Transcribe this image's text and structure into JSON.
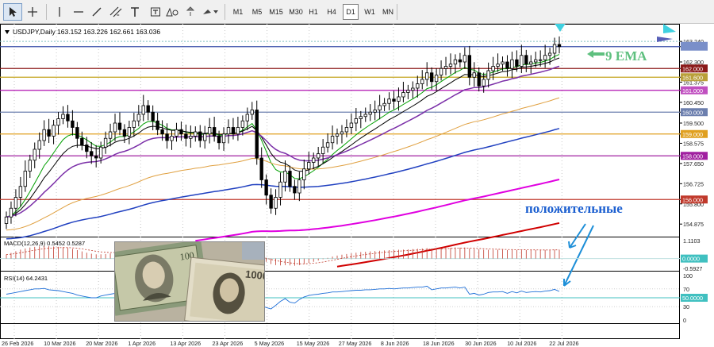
{
  "toolbar": {
    "timeframes": [
      "M1",
      "M5",
      "M15",
      "M30",
      "H1",
      "H4",
      "D1",
      "W1",
      "MN"
    ],
    "active_timeframe": "D1",
    "tools": [
      "cursor-icon",
      "crosshair-icon",
      "hline-icon",
      "trendline-icon",
      "channel-icon",
      "text-icon",
      "label-icon",
      "shapes-icon",
      "tools-more-icon"
    ]
  },
  "chart_data": {
    "type": "candlestick",
    "symbol_header": "USDJPY,Daily  163.152 163.226 162.661 163.036",
    "ylim": [
      154.3,
      163.9
    ],
    "y_ticks": [
      "163.240",
      "163.000",
      "162.300",
      "162.000",
      "161.600",
      "161.375",
      "161.000",
      "160.450",
      "160.000",
      "159.500",
      "159.000",
      "158.575",
      "158.000",
      "157.650",
      "156.725",
      "156.000",
      "155.800",
      "154.875"
    ],
    "horizontal_levels": [
      {
        "value": 163.0,
        "color": "#3a4fa8",
        "tag_color": "#7a8fc9"
      },
      {
        "value": 162.0,
        "color": "#8b1a1a",
        "tag_color": "#8b1a1a"
      },
      {
        "value": 161.6,
        "color": "#c5a41f",
        "tag_color": "#b9a03a"
      },
      {
        "value": 161.0,
        "color": "#b010b0",
        "tag_color": "#c050c0"
      },
      {
        "value": 160.0,
        "color": "#6c7fae",
        "tag_color": "#6c7fae"
      },
      {
        "value": 159.0,
        "color": "#e0a020",
        "tag_color": "#e0a020"
      },
      {
        "value": 158.0,
        "color": "#a020a0",
        "tag_color": "#a020a0"
      },
      {
        "value": 156.0,
        "color": "#c0392b",
        "tag_color": "#c0392b"
      }
    ],
    "x_labels": [
      "26 Feb 2026",
      "10 Mar 2026",
      "20 Mar 2026",
      "1 Apr 2026",
      "13 Apr 2026",
      "23 Apr 2026",
      "5 May 2026",
      "15 May 2026",
      "27 May 2026",
      "8 Jun 2026",
      "18 Jun 2026",
      "30 Jun 2026",
      "10 Jul 2026",
      "22 Jul 2026"
    ],
    "closes": [
      155.2,
      155.6,
      156.1,
      156.6,
      157.3,
      157.8,
      158.3,
      158.7,
      159.2,
      158.9,
      159.4,
      159.7,
      159.9,
      159.6,
      159.3,
      158.8,
      158.5,
      158.2,
      158.0,
      157.9,
      158.4,
      158.8,
      159.1,
      159.5,
      159.2,
      158.9,
      159.3,
      159.6,
      159.9,
      160.3,
      160.0,
      159.6,
      159.2,
      159.0,
      158.7,
      158.9,
      159.2,
      159.0,
      158.8,
      158.9,
      159.1,
      158.7,
      159.0,
      159.3,
      158.9,
      158.6,
      159.0,
      159.3,
      159.0,
      159.3,
      159.6,
      159.9,
      160.1,
      157.9,
      156.9,
      156.2,
      155.6,
      156.1,
      156.8,
      157.3,
      156.6,
      156.3,
      156.9,
      157.4,
      157.7,
      157.9,
      158.1,
      158.4,
      158.6,
      158.9,
      159.0,
      159.1,
      159.3,
      159.5,
      159.7,
      159.8,
      159.9,
      160.0,
      160.1,
      160.3,
      160.4,
      160.6,
      160.5,
      160.7,
      160.9,
      161.0,
      161.1,
      161.3,
      161.5,
      161.8,
      161.4,
      161.7,
      162.0,
      162.1,
      162.2,
      162.4,
      162.3,
      162.6,
      161.6,
      161.8,
      161.2,
      161.5,
      161.9,
      162.1,
      162.2,
      162.3,
      162.0,
      162.4,
      162.1,
      162.6,
      162.2,
      162.3,
      162.4,
      162.4,
      162.6,
      162.7,
      163.1,
      163.0
    ],
    "ma_lines": [
      {
        "name": "9 EMA",
        "color": "#00a000",
        "width": 1
      },
      {
        "color": "#000000",
        "width": 1
      },
      {
        "color": "#7b2fa8",
        "width": 1.5
      },
      {
        "color": "#e0a040",
        "width": 1
      },
      {
        "color": "#2040c0",
        "width": 1.5
      },
      {
        "color": "#e000e0",
        "width": 2
      },
      {
        "color": "#d00000",
        "width": 2
      }
    ],
    "annotations": {
      "ema_label": "9 EMA",
      "positive_label": "положительные"
    },
    "macd": {
      "header": "MACD(12,26,9) 0.5452 0.5287",
      "ticks": [
        "1.1103",
        "0.0000",
        "-0.5927"
      ],
      "ylim": [
        -0.75,
        1.25
      ],
      "values": [
        0.25,
        0.35,
        0.45,
        0.55,
        0.62,
        0.68,
        0.72,
        0.75,
        0.78,
        0.76,
        0.74,
        0.72,
        0.7,
        0.66,
        0.6,
        0.52,
        0.44,
        0.36,
        0.3,
        0.26,
        0.26,
        0.28,
        0.32,
        0.36,
        0.38,
        0.38,
        0.4,
        0.42,
        0.44,
        0.46,
        0.46,
        0.42,
        0.36,
        0.3,
        0.22,
        0.16,
        0.12,
        0.08,
        0.04,
        0.02,
        0.02,
        0.0,
        0.0,
        0.02,
        0.02,
        0.0,
        0.02,
        0.04,
        0.06,
        0.08,
        0.12,
        0.16,
        0.2,
        0.1,
        -0.05,
        -0.2,
        -0.34,
        -0.4,
        -0.42,
        -0.4,
        -0.42,
        -0.44,
        -0.4,
        -0.34,
        -0.26,
        -0.2,
        -0.12,
        -0.04,
        0.04,
        0.12,
        0.18,
        0.24,
        0.28,
        0.32,
        0.36,
        0.4,
        0.42,
        0.44,
        0.46,
        0.48,
        0.5,
        0.52,
        0.53,
        0.54,
        0.55,
        0.56,
        0.58,
        0.6,
        0.62,
        0.64,
        0.62,
        0.62,
        0.64,
        0.66,
        0.66,
        0.68,
        0.67,
        0.68,
        0.62,
        0.6,
        0.56,
        0.54,
        0.54,
        0.54,
        0.54,
        0.54,
        0.52,
        0.53,
        0.52,
        0.53,
        0.52,
        0.52,
        0.52,
        0.52,
        0.53,
        0.53,
        0.54,
        0.5452
      ],
      "signal": 0.5287
    },
    "rsi": {
      "header": "RSI(14) 64.2431",
      "ticks": [
        "100",
        "70",
        "50.0000",
        "30",
        "0"
      ],
      "ylim": [
        0,
        100
      ],
      "level": 50,
      "values": [
        58,
        60,
        62,
        64,
        66,
        68,
        70,
        70,
        71,
        68,
        67,
        66,
        64,
        62,
        60,
        56,
        54,
        52,
        50,
        50,
        54,
        56,
        58,
        60,
        57,
        55,
        58,
        60,
        62,
        64,
        60,
        56,
        52,
        50,
        48,
        50,
        52,
        50,
        48,
        50,
        52,
        48,
        50,
        52,
        49,
        47,
        50,
        52,
        50,
        52,
        55,
        57,
        59,
        40,
        32,
        28,
        25,
        33,
        42,
        48,
        40,
        38,
        46,
        52,
        55,
        57,
        58,
        60,
        61,
        63,
        63,
        64,
        65,
        66,
        67,
        67,
        68,
        68,
        69,
        70,
        70,
        71,
        70,
        71,
        72,
        72,
        73,
        74,
        74,
        76,
        68,
        70,
        72,
        72,
        73,
        74,
        72,
        74,
        58,
        60,
        56,
        58,
        62,
        63,
        63,
        64,
        60,
        64,
        61,
        65,
        62,
        63,
        64,
        63,
        65,
        66,
        69,
        64.2431
      ]
    },
    "watermark_text": "1000"
  }
}
